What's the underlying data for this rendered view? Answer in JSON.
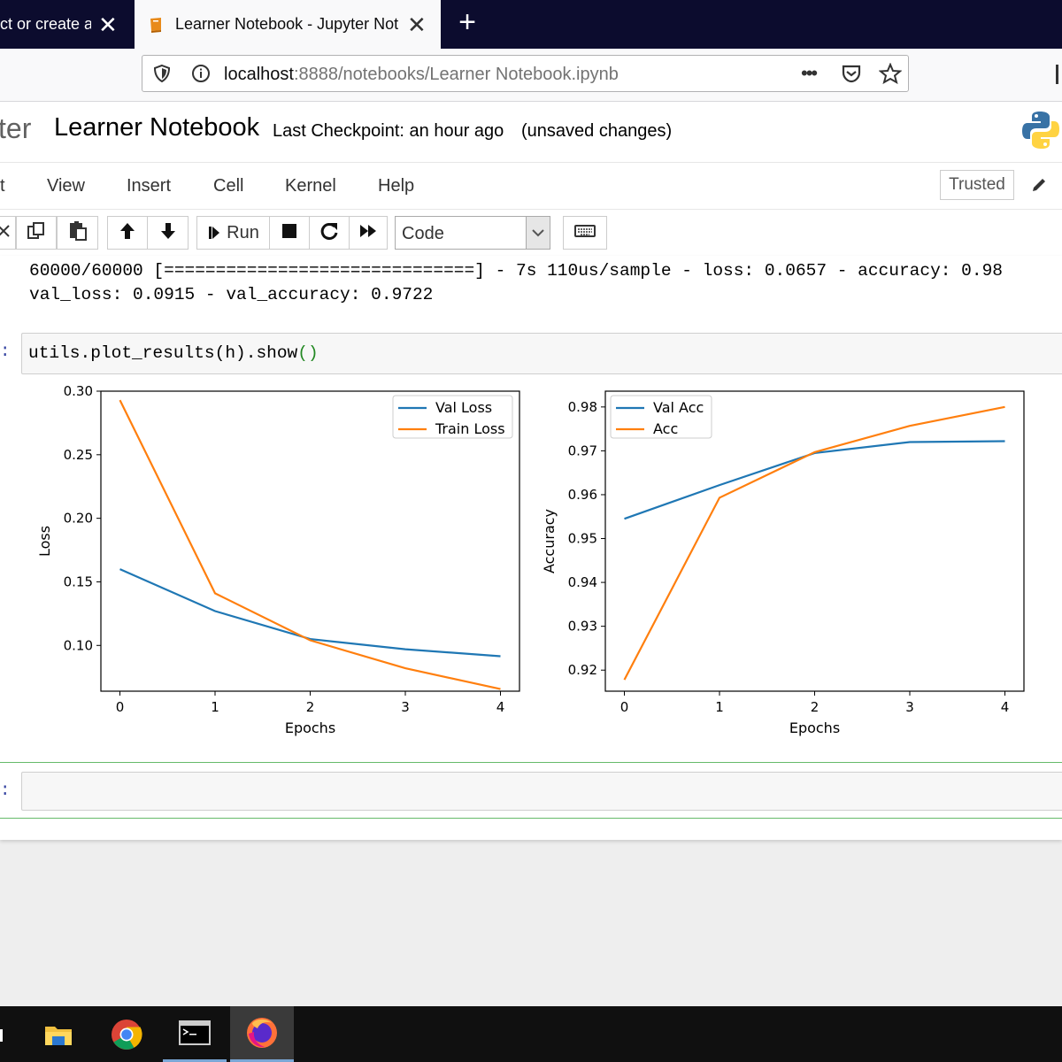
{
  "browser": {
    "tabs": [
      {
        "label": "ct or create a",
        "active": false
      },
      {
        "label": "Learner Notebook - Jupyter Not",
        "active": true
      }
    ],
    "new_tab": "+",
    "url_host": "localhost",
    "url_rest": ":8888/notebooks/Learner Notebook.ipynb",
    "page_actions": "•••"
  },
  "jupyter": {
    "logo_text": "ter",
    "notebook_title": "Learner Notebook",
    "checkpoint": "Last Checkpoint: an hour ago",
    "save_status": "(unsaved changes)",
    "menu": [
      "t",
      "View",
      "Insert",
      "Cell",
      "Kernel",
      "Help"
    ],
    "trusted": "Trusted",
    "toolbar": {
      "run_label": "Run",
      "cell_type": "Code"
    }
  },
  "cells": {
    "output_line1": "60000/60000 [==============================] - 7s 110us/sample - loss: 0.0657 - accuracy: 0.98",
    "output_line2": "val_loss: 0.0915 - val_accuracy: 0.9722",
    "prompt": ":",
    "code_main": "utils.plot_results(h).show",
    "code_parens": "()",
    "empty_prompt": ":"
  },
  "chart_data": [
    {
      "type": "line",
      "xlabel": "Epochs",
      "ylabel": "Loss",
      "x": [
        0,
        1,
        2,
        3,
        4
      ],
      "xlim": [
        -0.2,
        4.2
      ],
      "ylim": [
        0.064,
        0.3
      ],
      "yticks": [
        "0.10",
        "0.15",
        "0.20",
        "0.25",
        "0.30"
      ],
      "ytick_values": [
        0.1,
        0.15,
        0.2,
        0.25,
        0.3
      ],
      "xticks": [
        "0",
        "1",
        "2",
        "3",
        "4"
      ],
      "legend": "top-right",
      "series": [
        {
          "name": "Val Loss",
          "color": "#1f77b4",
          "values": [
            0.16,
            0.127,
            0.105,
            0.097,
            0.0915
          ]
        },
        {
          "name": "Train Loss",
          "color": "#ff7f0e",
          "values": [
            0.293,
            0.141,
            0.104,
            0.082,
            0.0657
          ]
        }
      ]
    },
    {
      "type": "line",
      "xlabel": "Epochs",
      "ylabel": "Accuracy",
      "x": [
        0,
        1,
        2,
        3,
        4
      ],
      "xlim": [
        -0.2,
        4.2
      ],
      "ylim": [
        0.9152,
        0.9836
      ],
      "yticks": [
        "0.92",
        "0.93",
        "0.94",
        "0.95",
        "0.96",
        "0.97",
        "0.98"
      ],
      "ytick_values": [
        0.92,
        0.93,
        0.94,
        0.95,
        0.96,
        0.97,
        0.98
      ],
      "xticks": [
        "0",
        "1",
        "2",
        "3",
        "4"
      ],
      "legend": "top-left",
      "series": [
        {
          "name": "Val Acc",
          "color": "#1f77b4",
          "values": [
            0.9545,
            0.9622,
            0.9695,
            0.972,
            0.9722
          ]
        },
        {
          "name": "Acc",
          "color": "#ff7f0e",
          "values": [
            0.9178,
            0.9593,
            0.9697,
            0.9757,
            0.98
          ]
        }
      ]
    }
  ]
}
